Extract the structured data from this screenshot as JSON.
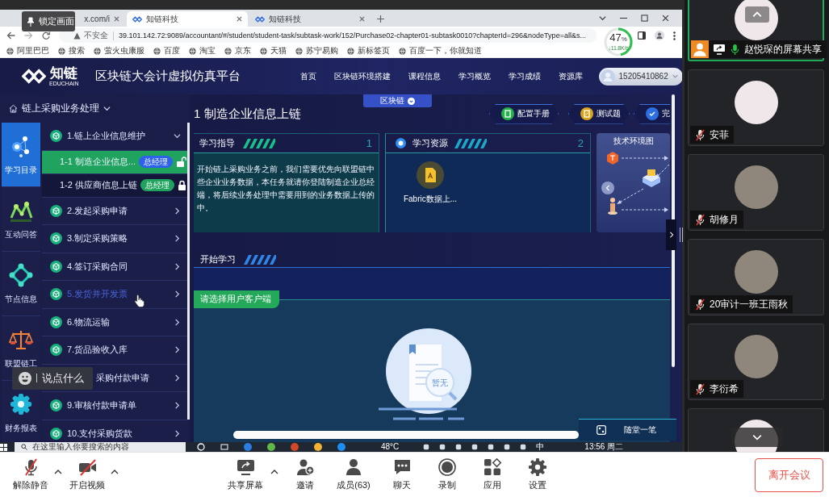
{
  "lock_overlay": {
    "label": "锁定画面"
  },
  "browser": {
    "tabs": [
      {
        "title": "x.com/i",
        "selected": false
      },
      {
        "title": "知链科技",
        "selected": true
      },
      {
        "title": "知链科技",
        "selected": false
      }
    ],
    "security": "不安全",
    "url": "39.101.142.72:9089/accountant/#/student/student-task/subtask-work/152/Purchase02-chapter01-subtask0010?chapterId=296&nodeType=all&s...",
    "net_meter": {
      "percent": "47",
      "unit": "%",
      "speed": "↓11.8K/s",
      "level": 0.47
    },
    "bookmarks": [
      "阿里巴巴",
      "搜索",
      "萤火虫康服",
      "百度",
      "淘宝",
      "京东",
      "天猫",
      "苏宁易购",
      "新标签页",
      "百度一下，你就知道"
    ]
  },
  "app_header": {
    "logo": "知链",
    "logo_sub": "EDUCHAIN",
    "platform": "区块链大会计虚拟仿真平台",
    "nav": [
      "首页",
      "区块链环境搭建",
      "课程信息",
      "学习概览",
      "学习成绩",
      "资源库"
    ],
    "user": "15205410862"
  },
  "breadcrumb": "链上采购业务处理",
  "side_nav": [
    {
      "label": "学习目录",
      "kind": "catalog",
      "selected": true
    },
    {
      "label": "互动问答",
      "kind": "qa",
      "selected": false
    },
    {
      "label": "节点信息",
      "kind": "nodes",
      "selected": false
    },
    {
      "label": "联盟链工",
      "kind": "scale",
      "selected": false
    },
    {
      "label": "财务报表",
      "kind": "report",
      "selected": false
    }
  ],
  "task_menu": [
    {
      "label": "1.链上企业信息维护",
      "expanded": true,
      "hovered": false,
      "children": [
        {
          "label": "1-1 制造企业信息...",
          "role": "总经理",
          "selected": true,
          "locked": false
        },
        {
          "label": "1-2 供应商信息上链",
          "role": "总经理",
          "selected": false,
          "locked": true
        }
      ]
    },
    {
      "label": "2.发起采购申请",
      "expanded": false,
      "hovered": false
    },
    {
      "label": "3.制定采购策略",
      "expanded": false,
      "hovered": false
    },
    {
      "label": "4.签订采购合同",
      "expanded": false,
      "hovered": false
    },
    {
      "label": "5.发货并开发票",
      "expanded": false,
      "hovered": true
    },
    {
      "label": "6.物流运输",
      "expanded": false,
      "hovered": false
    },
    {
      "label": "7.货品验收入库",
      "expanded": false,
      "hovered": false
    },
    {
      "label": "采购付款申请",
      "expanded": false,
      "hovered": false,
      "covered_by": {
        "placeholder": "说点什么"
      }
    },
    {
      "label": "9.审核付款申请单",
      "expanded": false,
      "hovered": false
    },
    {
      "label": "10.支付采购货款",
      "expanded": false,
      "hovered": false
    }
  ],
  "content": {
    "tab": "区块链",
    "title": "1 制造企业信息上链",
    "actions": [
      {
        "label": "配置手册",
        "kind": "manual"
      },
      {
        "label": "测试题",
        "kind": "quiz"
      },
      {
        "label": "完",
        "kind": "done"
      }
    ],
    "guide": {
      "title": "学习指导",
      "number": "1",
      "lines": [
        "开始链上采购业务之前，我们需要优先向联盟链中",
        "些企业业务数据，本任务就请你登陆制造企业总经",
        "端，将后续业务处理中需要用到的业务数据上传的",
        "中。"
      ]
    },
    "resources": {
      "title": "学习资源",
      "number": "2",
      "items": [
        {
          "name": "Fabric数据上..."
        }
      ]
    },
    "diagram": {
      "title": "技术环境图"
    },
    "start": {
      "title": "开始学习",
      "client_tab": "请选择用户客户端",
      "empty": "暂无"
    },
    "note_button": "随堂一笔"
  },
  "taskbar": {
    "search_placeholder": "在这里输入你要搜索的内容",
    "weather": "48°C",
    "ime": "中",
    "clock": "13:56 周二"
  },
  "participants": [
    {
      "name": "赵悦琛的屏幕共享",
      "kind": "cartoon",
      "active": true,
      "sharing": true,
      "muted": false
    },
    {
      "name": "安菲",
      "kind": "cartoon",
      "active": false,
      "sharing": false,
      "muted": true
    },
    {
      "name": "胡修月",
      "kind": "photo",
      "active": false,
      "sharing": false,
      "muted": true
    },
    {
      "name": "20审计一班王雨秋",
      "kind": "photo",
      "active": false,
      "sharing": false,
      "muted": true
    },
    {
      "name": "李衍希",
      "kind": "photo",
      "active": false,
      "sharing": false,
      "muted": true
    },
    {
      "kind": "cartoon",
      "active": false
    }
  ],
  "toolbar": {
    "tools": [
      {
        "kind": "mic",
        "label": "解除静音",
        "off": true,
        "menu": true
      },
      {
        "kind": "video",
        "label": "开启视频",
        "off": true,
        "menu": true
      },
      {
        "kind": "share",
        "label": "共享屏幕",
        "off": false,
        "menu": true
      },
      {
        "kind": "invite",
        "label": "邀请",
        "off": false,
        "menu": false
      },
      {
        "kind": "members",
        "label": "成员(63)",
        "off": false,
        "menu": false
      },
      {
        "kind": "chat",
        "label": "聊天",
        "off": false,
        "menu": false
      },
      {
        "kind": "record",
        "label": "录制",
        "off": false,
        "menu": false
      },
      {
        "kind": "apps",
        "label": "应用",
        "off": false,
        "menu": false
      },
      {
        "kind": "settings",
        "label": "设置",
        "off": false,
        "menu": false
      }
    ],
    "leave": "离开会议"
  }
}
